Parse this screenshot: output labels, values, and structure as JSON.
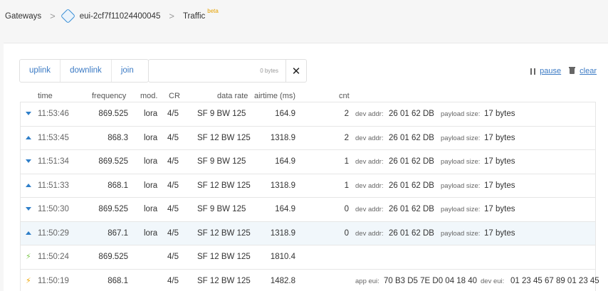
{
  "breadcrumb": {
    "root": "Gateways",
    "gateway": "eui-2cf7f11024400045",
    "page": "Traffic",
    "badge": "beta",
    "separator": ">"
  },
  "filters": {
    "uplink": "uplink",
    "downlink": "downlink",
    "join": "join",
    "bytes_placeholder": "0 bytes",
    "clear_symbol": "✕"
  },
  "actions": {
    "pause": "pause",
    "clear": "clear"
  },
  "columns": {
    "time": "time",
    "frequency": "frequency",
    "mod": "mod.",
    "cr": "CR",
    "data_rate": "data rate",
    "airtime": "airtime (ms)",
    "cnt": "cnt"
  },
  "labels": {
    "dev_addr": "dev addr:",
    "payload_size": "payload size:",
    "app_eui": "app eui:",
    "dev_eui": "dev eui:"
  },
  "colors": {
    "accent": "#2f7fc9",
    "join_uplink": "#f0a500",
    "join_downlink": "#7cc84a",
    "highlight": "#f1f7fb"
  },
  "rows": [
    {
      "dir": "down",
      "icon": "arrow-down-icon",
      "time": "11:53:46",
      "freq": "869.525",
      "mod": "lora",
      "cr": "4/5",
      "dr": "SF 9  BW 125",
      "air": "164.9",
      "cnt": "2",
      "addr": "26 01 62 DB",
      "payload": "17 bytes"
    },
    {
      "dir": "up",
      "icon": "arrow-up-icon",
      "time": "11:53:45",
      "freq": "868.3",
      "mod": "lora",
      "cr": "4/5",
      "dr": "SF 12  BW 125",
      "air": "1318.9",
      "cnt": "2",
      "addr": "26 01 62 DB",
      "payload": "17 bytes"
    },
    {
      "dir": "down",
      "icon": "arrow-down-icon",
      "time": "11:51:34",
      "freq": "869.525",
      "mod": "lora",
      "cr": "4/5",
      "dr": "SF 9  BW 125",
      "air": "164.9",
      "cnt": "1",
      "addr": "26 01 62 DB",
      "payload": "17 bytes"
    },
    {
      "dir": "up",
      "icon": "arrow-up-icon",
      "time": "11:51:33",
      "freq": "868.1",
      "mod": "lora",
      "cr": "4/5",
      "dr": "SF 12  BW 125",
      "air": "1318.9",
      "cnt": "1",
      "addr": "26 01 62 DB",
      "payload": "17 bytes"
    },
    {
      "dir": "down",
      "icon": "arrow-down-icon",
      "time": "11:50:30",
      "freq": "869.525",
      "mod": "lora",
      "cr": "4/5",
      "dr": "SF 9  BW 125",
      "air": "164.9",
      "cnt": "0",
      "addr": "26 01 62 DB",
      "payload": "17 bytes"
    },
    {
      "dir": "up",
      "icon": "arrow-up-icon",
      "time": "11:50:29",
      "freq": "867.1",
      "mod": "lora",
      "cr": "4/5",
      "dr": "SF 12  BW 125",
      "air": "1318.9",
      "cnt": "0",
      "addr": "26 01 62 DB",
      "payload": "17 bytes",
      "highlight": true
    },
    {
      "dir": "join-down",
      "icon": "bolt-icon",
      "glyph": "⚡",
      "time": "11:50:24",
      "freq": "869.525",
      "mod": "",
      "cr": "4/5",
      "dr": "SF 12  BW 125",
      "air": "1810.4",
      "cnt": ""
    },
    {
      "dir": "join-up",
      "icon": "bolt-icon",
      "glyph": "⚡",
      "time": "11:50:19",
      "freq": "868.1",
      "mod": "",
      "cr": "4/5",
      "dr": "SF 12  BW 125",
      "air": "1482.8",
      "cnt": "",
      "app_eui": "70 B3 D5 7E D0 04 18 40",
      "dev_eui": "01 23 45 67 89 01 23 45"
    }
  ]
}
